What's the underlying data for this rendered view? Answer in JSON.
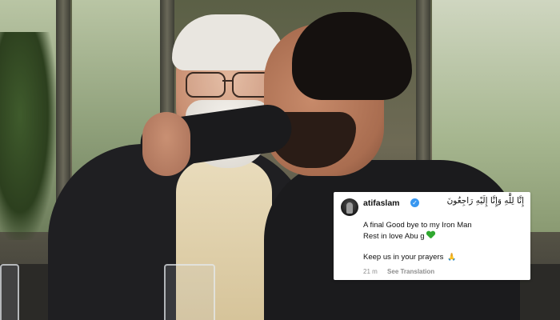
{
  "photo": {
    "description_icon": "photo-background"
  },
  "comment": {
    "username": "atifaslam",
    "verified_icon": "verified-badge-icon",
    "arabic_text": "إِنَّا لِلَّٰهِ وَإِنَّا إِلَيْهِ رَاجِعُونَ",
    "line1": "A final Good bye to my Iron Man",
    "line2": "Rest in love Abu g",
    "line2_emoji": "green-heart-icon",
    "line3": "Keep us in your prayers",
    "line3_emoji": "🙏",
    "time": "21 m",
    "see_translation": "See Translation"
  },
  "colors": {
    "verified_blue": "#3897f0",
    "heart_green": "#2fa82f",
    "meta_gray": "#8e8e8e"
  }
}
